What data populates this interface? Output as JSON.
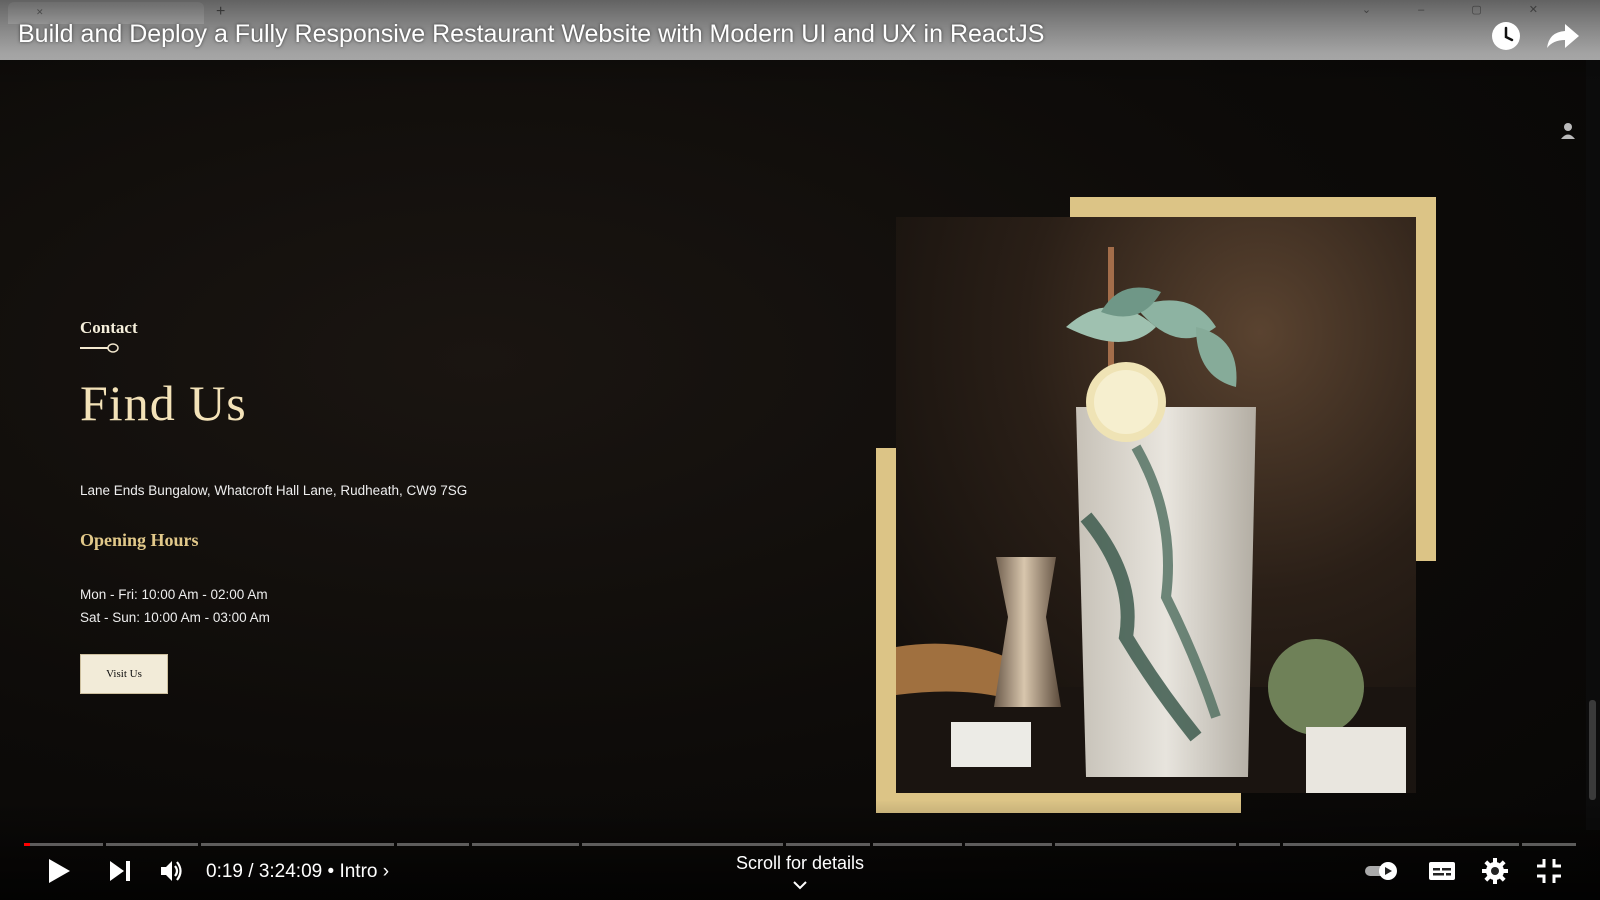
{
  "player": {
    "title": "Build and Deploy a Fully Responsive Restaurant Website with Modern UI and UX in ReactJS",
    "time_current": "0:19",
    "time_total": "3:24:09",
    "time_separator": " / ",
    "chapter": "Intro",
    "scroll_hint": "Scroll for details",
    "progress": 0.0016,
    "accent_color": "#ff0000",
    "icons": {
      "play": "play-icon",
      "next": "next-icon",
      "volume": "volume-icon",
      "autoplay": "autoplay-toggle-icon",
      "captions": "captions-icon",
      "settings": "gear-icon",
      "exit_fullscreen": "exit-fullscreen-icon",
      "watch_later": "clock-icon",
      "share": "share-icon"
    }
  },
  "page": {
    "eyebrow": "Contact",
    "headline": "Find Us",
    "address": "Lane Ends Bungalow, Whatcroft Hall Lane, Rudheath, CW9 7SG",
    "hours_title": "Opening Hours",
    "hours": [
      "Mon - Fri: 10:00 Am - 02:00 Am",
      "Sat - Sun: 10:00 Am - 03:00 Am"
    ],
    "cta_label": "Visit Us",
    "gold_color": "#dcc486",
    "headline_color": "#f3e2b8"
  }
}
